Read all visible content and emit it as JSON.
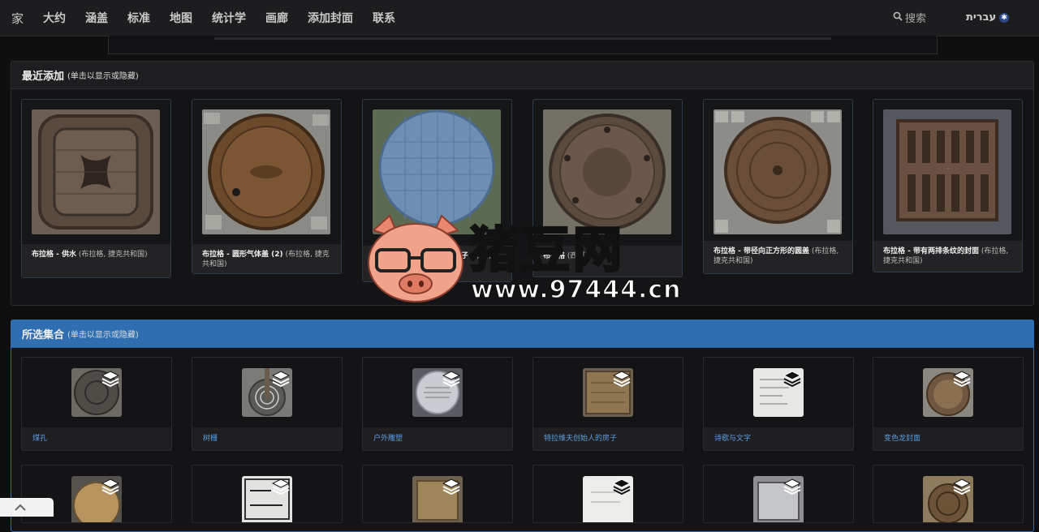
{
  "nav": {
    "items": [
      "家",
      "大约",
      "涵盖",
      "标准",
      "地图",
      "统计学",
      "画廊",
      "添加封面",
      "联系"
    ],
    "search_label": "搜索",
    "language": "עברית"
  },
  "recent": {
    "title": "最近添加",
    "hint": "(单击以显示或隐藏)",
    "cards": [
      {
        "title": "布拉格 - 供水",
        "sub": "(布拉格, 捷克共和国)"
      },
      {
        "title": "布拉格 - 圆形气体盖 (2)",
        "sub": "(布拉格, 捷克共和国)"
      },
      {
        "title": "布拉格 - Aquerawin的盖子",
        "sub": "(布拉格, 捷克共和国)"
      },
      {
        "title": "布拉格",
        "sub": "(西部)"
      },
      {
        "title": "布拉格 - 带径向正方形的圆盖",
        "sub": "(布拉格, 捷克共和国)"
      },
      {
        "title": "布拉格 - 带有两排条纹的封面",
        "sub": "(布拉格, 捷克共和国)"
      }
    ]
  },
  "collections": {
    "title": "所选集合",
    "hint": "(单击以显示或隐藏)",
    "items": [
      "煤孔",
      "树栅",
      "户外雕塑",
      "特拉维夫创始人的房子",
      "诗歌与文字",
      "变色龙封面"
    ]
  },
  "watermark": {
    "text": "猪豆网",
    "url": "www.97444.cn"
  },
  "colors": {
    "accent_blue": "#2f6fb1",
    "link": "#5c9ee0",
    "background": "#0f0f10"
  }
}
